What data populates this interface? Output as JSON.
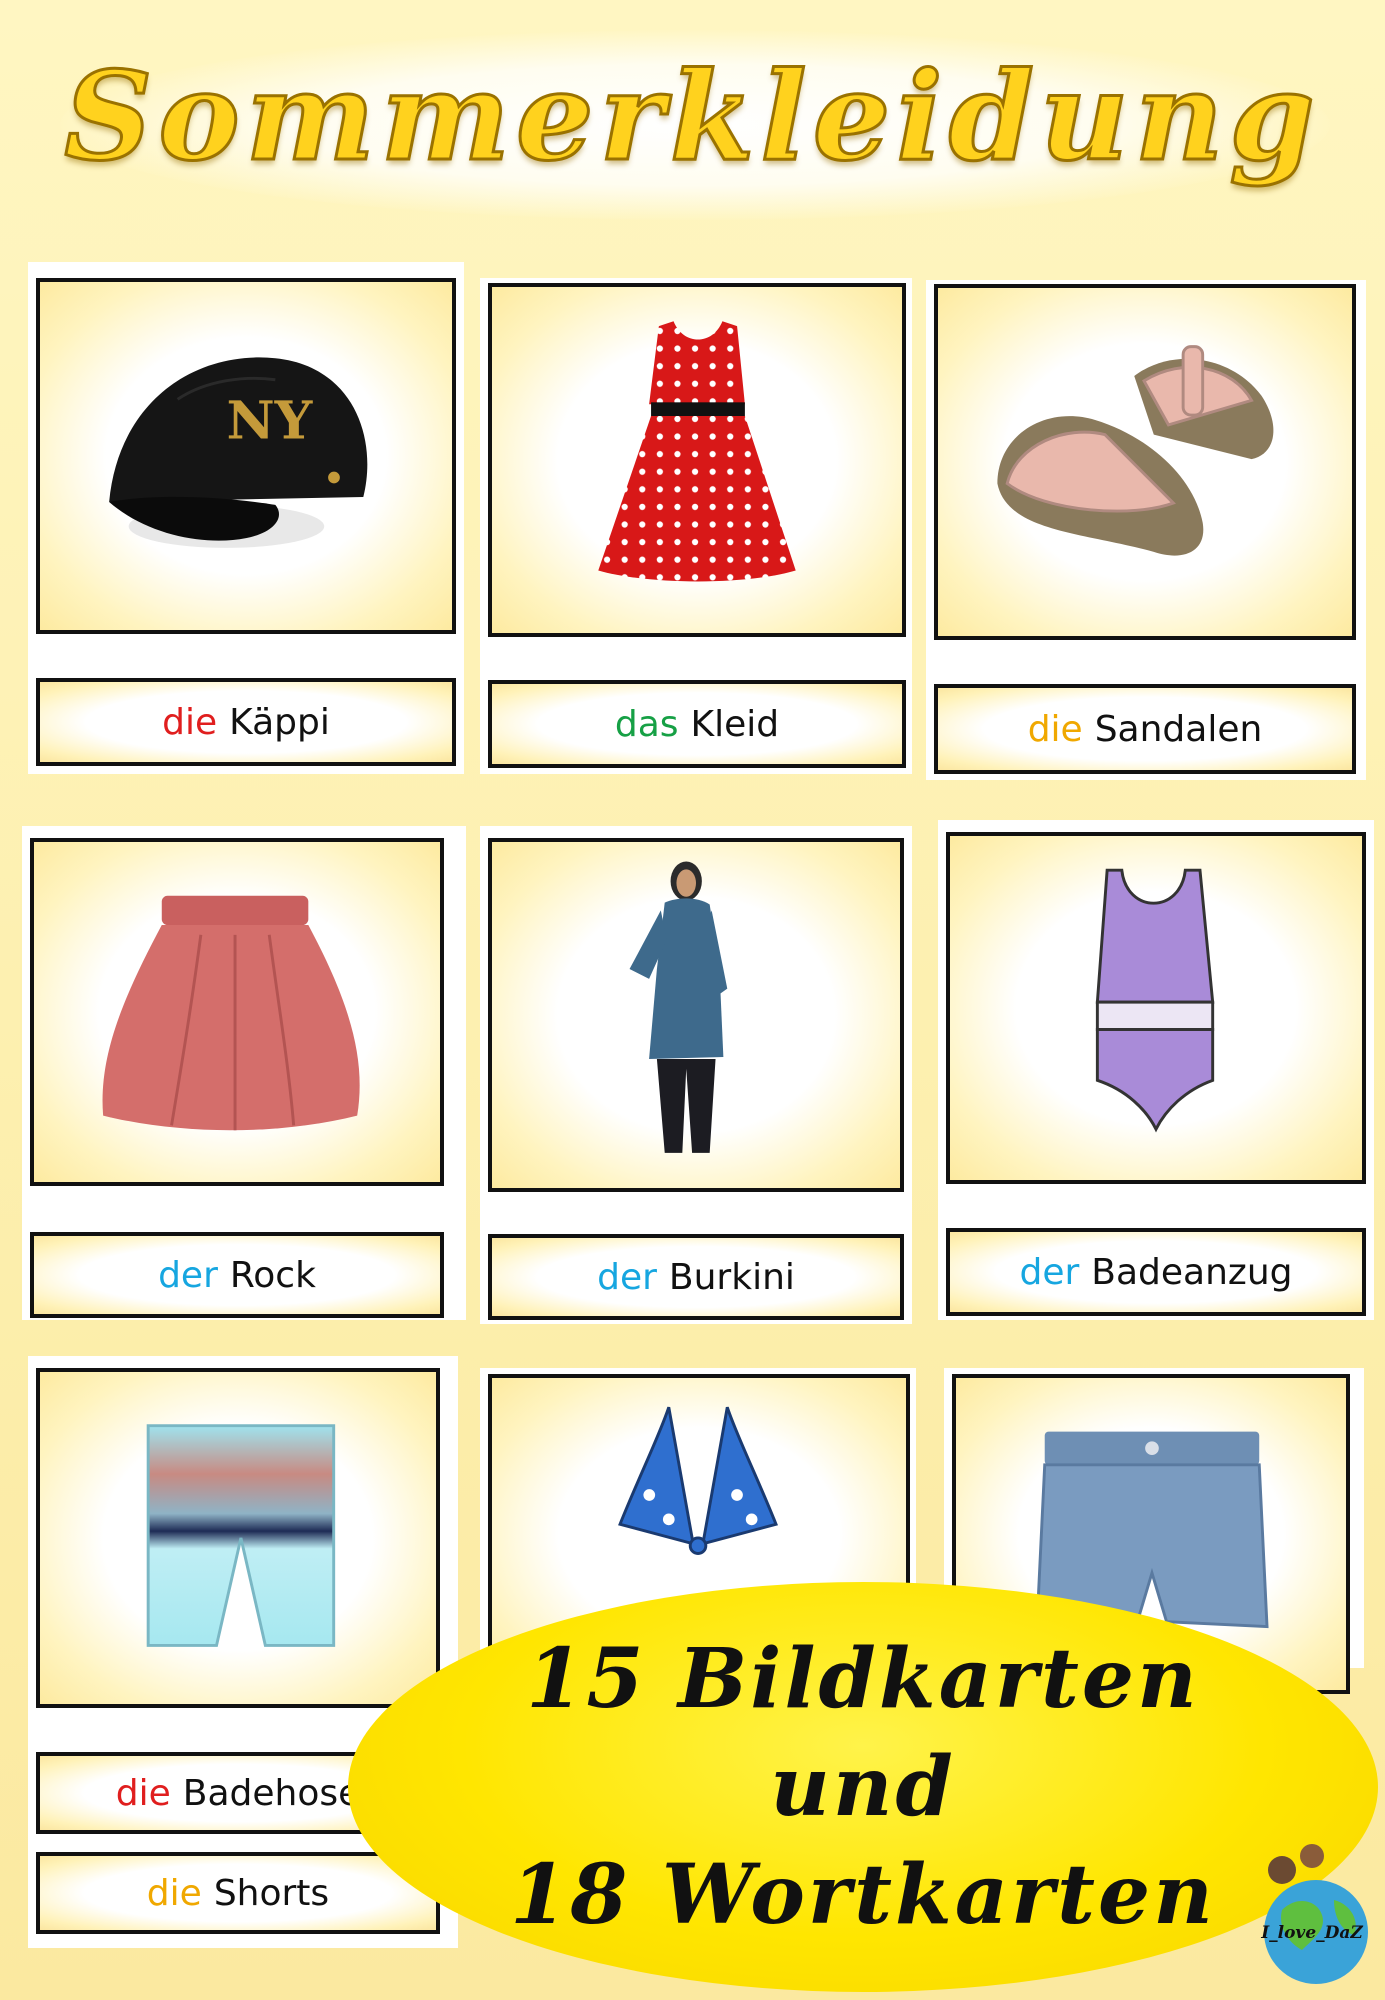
{
  "title": "Sommerkleidung",
  "cards": [
    {
      "article": "die",
      "word": "Käppi",
      "image": "cap-icon"
    },
    {
      "article": "das",
      "word": "Kleid",
      "image": "dress-icon"
    },
    {
      "article": "die",
      "word": "Sandalen",
      "image": "sandals-icon"
    },
    {
      "article": "der",
      "word": "Rock",
      "image": "skirt-icon"
    },
    {
      "article": "der",
      "word": "Burkini",
      "image": "burkini-icon"
    },
    {
      "article": "der",
      "word": "Badeanzug",
      "image": "swimsuit-icon"
    },
    {
      "article": "die",
      "word": "Badehose",
      "image": "swim-trunks-icon"
    },
    {
      "article": "die",
      "word": "Shorts",
      "image": ""
    },
    {
      "article": "",
      "word": "",
      "image": "bikini-top-icon"
    },
    {
      "article": "",
      "word": "",
      "image": "denim-shorts-icon"
    }
  ],
  "article_colors": {
    "die_red": "#e01e1e",
    "das": "#16a045",
    "die_orange": "#f0a800",
    "der": "#16a6e0"
  },
  "promo": {
    "line1": "15 Bildkarten",
    "line2": "und",
    "line3": "18 Wortkarten"
  },
  "logo_text": "I_love_DaZ"
}
